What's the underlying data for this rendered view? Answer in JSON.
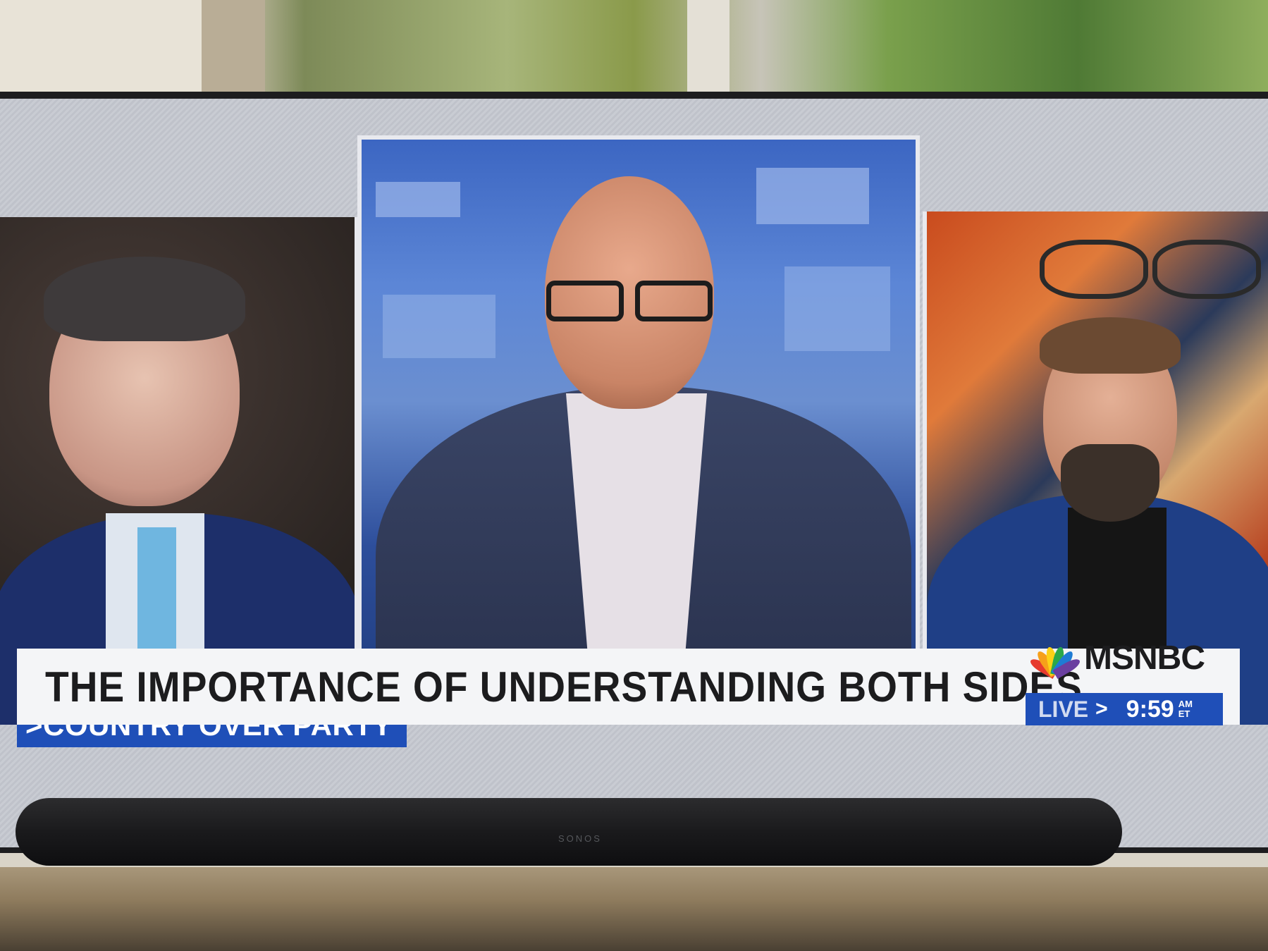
{
  "lower_third": {
    "kicker": "COUNTRY OVER PARTY",
    "kicker_prefix": ">",
    "headline": "THE IMPORTANCE OF UNDERSTANDING BOTH SIDES"
  },
  "network": {
    "name": "MSNBC",
    "live_label": "LIVE",
    "live_arrow": ">",
    "time": "9:59",
    "am": "AM",
    "tz": "ET"
  },
  "soundbar": {
    "brand": "SONOS"
  },
  "colors": {
    "accent_blue": "#1f4fb8",
    "headline_bg": "#f4f5f7",
    "headline_text": "#1c1c1e"
  }
}
